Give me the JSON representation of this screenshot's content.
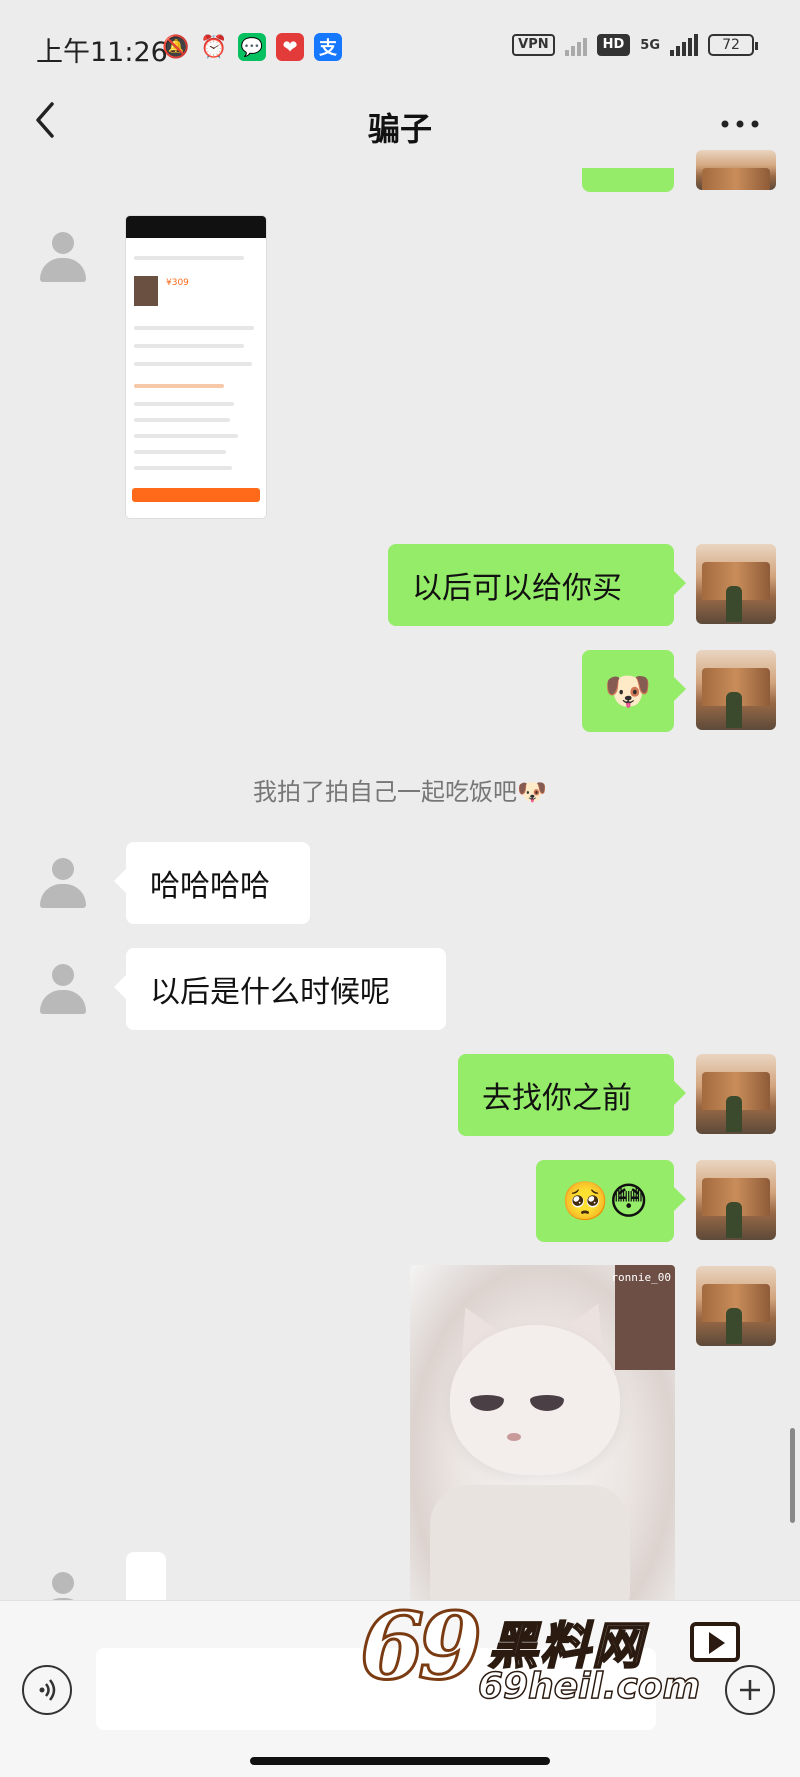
{
  "status_bar": {
    "time": "上午11:26",
    "vpn": "VPN",
    "hd": "HD",
    "network": "5G",
    "battery": "72"
  },
  "header": {
    "title": "骗子",
    "back_icon": "chevron-left-icon",
    "more_icon": "more-icon"
  },
  "messages": [
    {
      "side": "left",
      "type": "image",
      "content_desc": "screenshot",
      "price": "¥309"
    },
    {
      "side": "right",
      "type": "text",
      "text": "以后可以给你买"
    },
    {
      "side": "right",
      "type": "emoji",
      "text": "🐶"
    },
    {
      "side": "system",
      "type": "pat",
      "text": "我拍了拍自己一起吃饭吧🐶"
    },
    {
      "side": "left",
      "type": "text",
      "text": "哈哈哈哈"
    },
    {
      "side": "left",
      "type": "text",
      "text": "以后是什么时候呢"
    },
    {
      "side": "right",
      "type": "text",
      "text": "去找你之前"
    },
    {
      "side": "right",
      "type": "emoji",
      "text": "🥺😳"
    },
    {
      "side": "right",
      "type": "image",
      "watermark": "ronnie_00"
    }
  ],
  "input_bar": {
    "voice_icon": "voice-icon",
    "plus_icon": "plus-icon",
    "placeholder": ""
  },
  "watermark": {
    "logo": "69",
    "name": "黑料网",
    "domain": "69heil.com"
  },
  "colors": {
    "background": "#ececec",
    "bubble_self": "#95ec69",
    "bubble_other": "#ffffff"
  }
}
